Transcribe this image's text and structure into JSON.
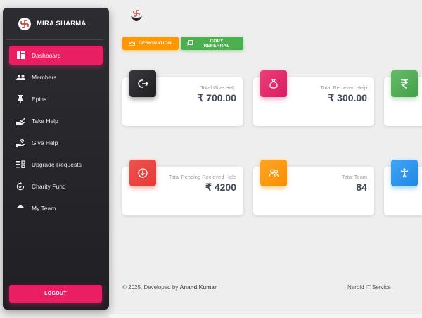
{
  "user": {
    "name": "MIRA SHARMA"
  },
  "sidebar": {
    "items": [
      {
        "label": "Dashboard",
        "icon": "dashboard-icon",
        "active": true
      },
      {
        "label": "Members",
        "icon": "people-icon"
      },
      {
        "label": "Epins",
        "icon": "pin-icon"
      },
      {
        "label": "Take Help",
        "icon": "take-help-icon"
      },
      {
        "label": "Give Help",
        "icon": "give-help-icon"
      },
      {
        "label": "Upgrade Requests",
        "icon": "upgrade-icon"
      },
      {
        "label": "Charity Fund",
        "icon": "charity-icon"
      },
      {
        "label": "My Team",
        "icon": "team-icon"
      }
    ],
    "logout_label": "LOGOUT"
  },
  "actions": {
    "designation_label": "DESIGNATION",
    "referral_label": "COPY REFERRAL"
  },
  "cards": [
    {
      "label": "Total Give Help",
      "value": "₹ 700.00",
      "icon": "redo-icon"
    },
    {
      "label": "Total Recieved Help",
      "value": "₹ 300.00",
      "icon": "money-bag-icon"
    },
    {
      "label": "",
      "value": "",
      "icon": "rupee-icon"
    },
    {
      "label": "Total Pending Recieved Help",
      "value": "₹ 4200",
      "icon": "download-circle-icon"
    },
    {
      "label": "Total Team",
      "value": "84",
      "icon": "group-icon"
    },
    {
      "label": "",
      "value": "",
      "icon": "person-icon"
    }
  ],
  "footer": {
    "copyright": "© 2025, Developed by ",
    "developer": "Anand Kumar",
    "company": "Nerold IT Service"
  },
  "colors": {
    "accent": "#e91e63",
    "orange": "#ff9800",
    "green": "#4caf50",
    "red": "#f44336",
    "blue": "#2196f3",
    "sidebar_bg": "#2a2a2e"
  }
}
